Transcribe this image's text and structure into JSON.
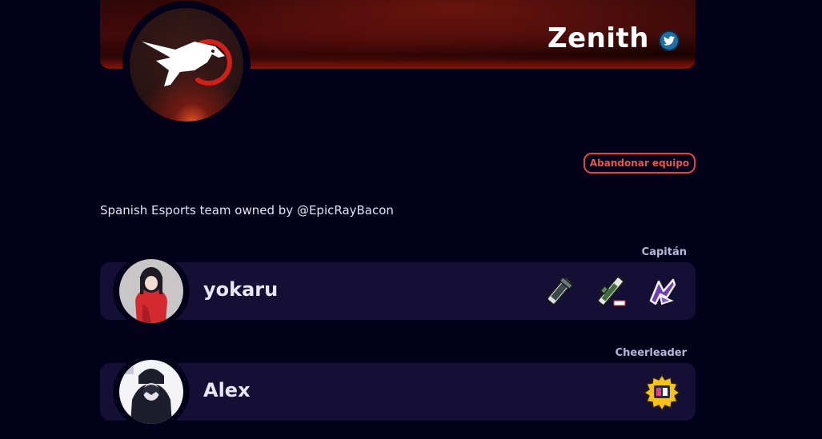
{
  "team": {
    "name": "Zenith",
    "description": "Spanish Esports team owned by @EpicRayBacon",
    "logo_icon": "eagle-logo-icon",
    "social_icon": "twitter-icon"
  },
  "actions": {
    "leave_label": "Abandonar equipo"
  },
  "members": [
    {
      "role": "Capitán",
      "name": "yokaru",
      "avatar_icon": "anime-girl-red-coat-avatar",
      "badges": [
        "splatling-weapon-icon",
        "charger-weapon-icon",
        "splat-bomb-icon"
      ]
    },
    {
      "role": "Cheerleader",
      "name": "Alex",
      "avatar_icon": "anime-girl-hooded-avatar",
      "badges": [
        "splat-sticker-badge-icon"
      ]
    }
  ],
  "colors": {
    "background": "#03001a",
    "card": "#150f36",
    "accent_red": "#e0473f",
    "role_label": "#b9b6d9",
    "twitter_blue": "#1d6fa8"
  }
}
